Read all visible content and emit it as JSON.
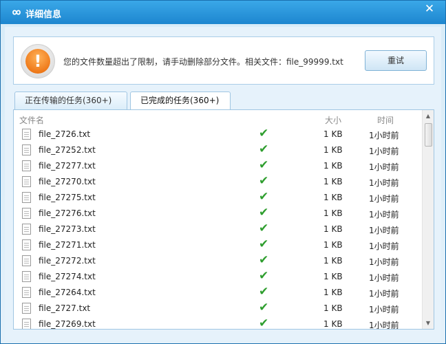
{
  "window": {
    "title": "详细信息",
    "close_glyph": "✕",
    "icon": "cloud-logo-icon"
  },
  "alert": {
    "icon": "warning-icon",
    "icon_glyph": "!",
    "message": "您的文件数量超出了限制，请手动删除部分文件。相关文件：file_99999.txt",
    "retry_label": "重试"
  },
  "tabs": [
    {
      "label": "正在传输的任务(360+)",
      "active": false
    },
    {
      "label": "已完成的任务(360+)",
      "active": true
    }
  ],
  "table": {
    "columns": {
      "name": "文件名",
      "size": "大小",
      "time": "时间"
    },
    "rows": [
      {
        "name": "file_2726.txt",
        "size": "1 KB",
        "time": "1小时前"
      },
      {
        "name": "file_27252.txt",
        "size": "1 KB",
        "time": "1小时前"
      },
      {
        "name": "file_27277.txt",
        "size": "1 KB",
        "time": "1小时前"
      },
      {
        "name": "file_27270.txt",
        "size": "1 KB",
        "time": "1小时前"
      },
      {
        "name": "file_27275.txt",
        "size": "1 KB",
        "time": "1小时前"
      },
      {
        "name": "file_27276.txt",
        "size": "1 KB",
        "time": "1小时前"
      },
      {
        "name": "file_27273.txt",
        "size": "1 KB",
        "time": "1小时前"
      },
      {
        "name": "file_27271.txt",
        "size": "1 KB",
        "time": "1小时前"
      },
      {
        "name": "file_27272.txt",
        "size": "1 KB",
        "time": "1小时前"
      },
      {
        "name": "file_27274.txt",
        "size": "1 KB",
        "time": "1小时前"
      },
      {
        "name": "file_27264.txt",
        "size": "1 KB",
        "time": "1小时前"
      },
      {
        "name": "file_2727.txt",
        "size": "1 KB",
        "time": "1小时前"
      },
      {
        "name": "file_27269.txt",
        "size": "1 KB",
        "time": "1小时前"
      }
    ],
    "done_glyph": "✔"
  },
  "colors": {
    "titlebar": "#1d86cf",
    "check": "#2f9e2f",
    "warning": "#ef7a1a"
  }
}
